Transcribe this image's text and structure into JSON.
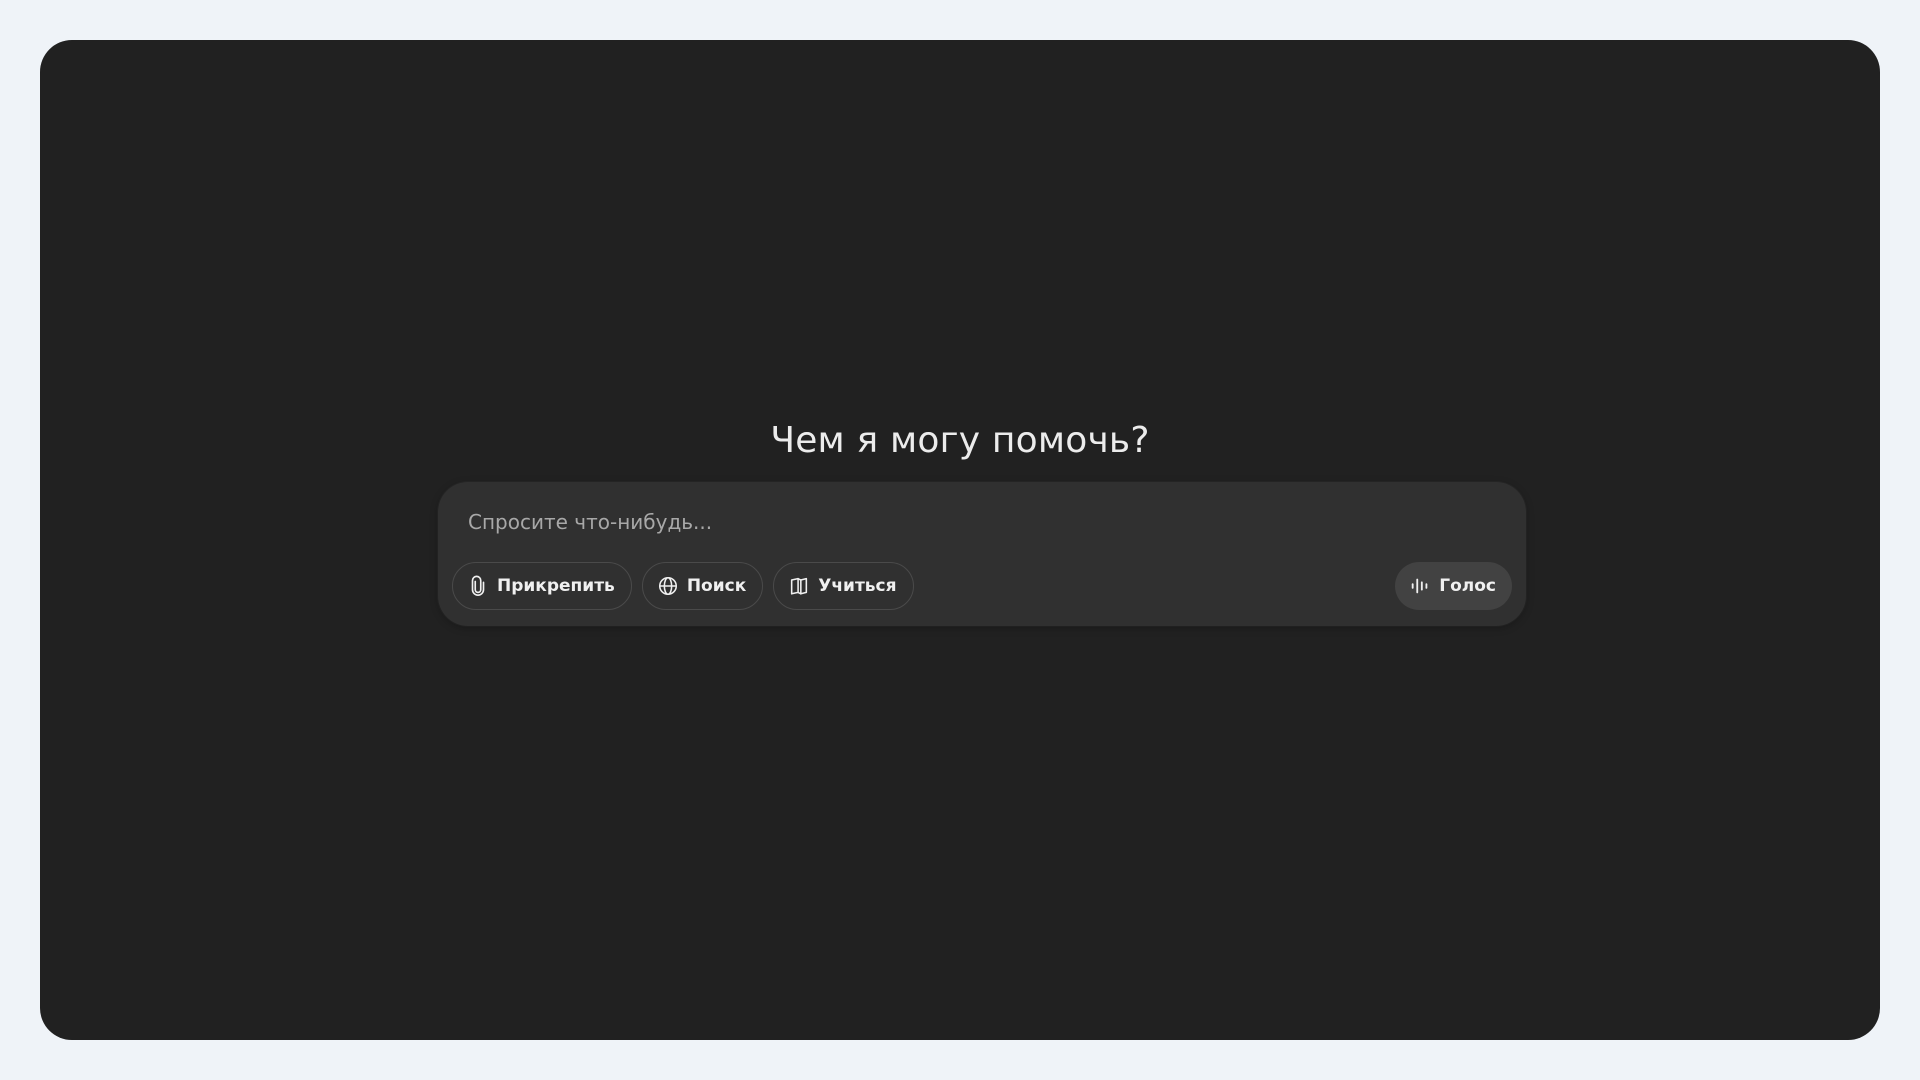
{
  "main": {
    "heading": "Чем я могу помочь?"
  },
  "composer": {
    "placeholder": "Спросите что-нибудь...",
    "tools": [
      {
        "label": "Прикрепить",
        "icon": "paperclip-icon"
      },
      {
        "label": "Поиск",
        "icon": "globe-icon"
      },
      {
        "label": "Учиться",
        "icon": "book-icon"
      }
    ],
    "voice": {
      "label": "Голос",
      "icon": "voice-waveform-icon"
    }
  },
  "colors": {
    "page_background": "#eff3f8",
    "window_background": "#212121",
    "composer_background": "#303030",
    "voice_button_background": "#424242",
    "text": "#ececec",
    "placeholder": "#a8a8a8"
  }
}
